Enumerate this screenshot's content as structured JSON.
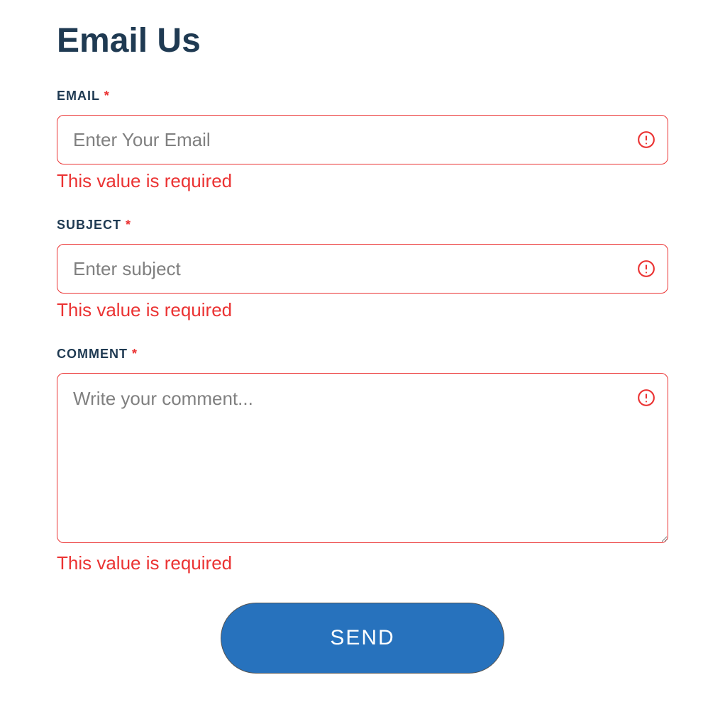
{
  "title": "Email Us",
  "fields": {
    "email": {
      "label": "EMAIL",
      "required_mark": "*",
      "placeholder": "Enter Your Email",
      "error": "This value is required"
    },
    "subject": {
      "label": "SUBJECT",
      "required_mark": "*",
      "placeholder": "Enter subject",
      "error": "This value is required"
    },
    "comment": {
      "label": "COMMENT",
      "required_mark": "*",
      "placeholder": "Write your comment...",
      "error": "This value is required"
    }
  },
  "submit_label": "SEND",
  "colors": {
    "heading": "#1f3a52",
    "error": "#eb3333",
    "button_bg": "#2772bd"
  }
}
